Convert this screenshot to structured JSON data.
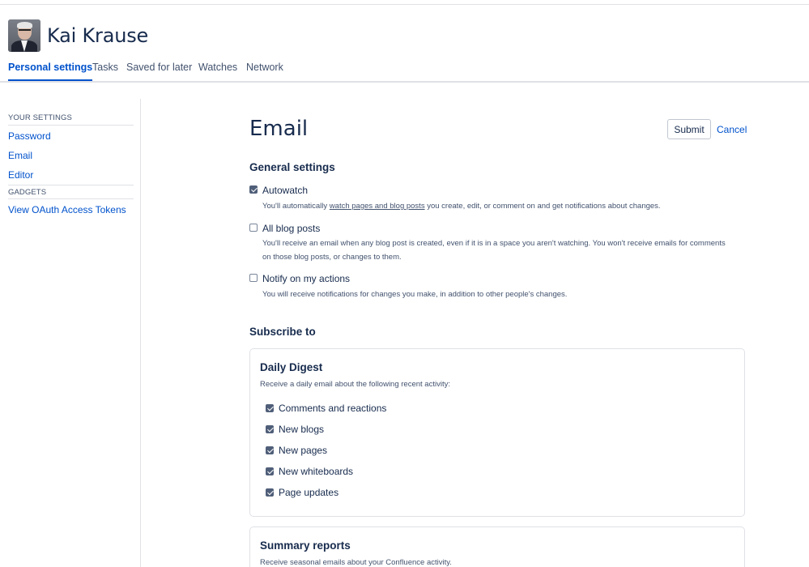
{
  "user": {
    "name": "Kai Krause"
  },
  "tabs": [
    {
      "label": "Personal settings",
      "active": true
    },
    {
      "label": "Tasks",
      "active": false
    },
    {
      "label": "Saved for later",
      "active": false
    },
    {
      "label": "Watches",
      "active": false
    },
    {
      "label": "Network",
      "active": false
    }
  ],
  "sidebar": {
    "your_settings_heading": "YOUR SETTINGS",
    "items": [
      {
        "label": "Password"
      },
      {
        "label": "Email"
      },
      {
        "label": "Editor"
      }
    ],
    "gadgets_heading": "GADGETS",
    "gadget_items": [
      {
        "label": "View OAuth Access Tokens"
      }
    ]
  },
  "page": {
    "title": "Email",
    "submit_label": "Submit",
    "cancel_label": "Cancel"
  },
  "general": {
    "heading": "General settings",
    "options": [
      {
        "label": "Autowatch",
        "checked": true,
        "desc_before": "You'll automatically ",
        "desc_link": "watch pages and blog posts",
        "desc_after": " you create, edit, or comment on and get notifications about changes."
      },
      {
        "label": "All blog posts",
        "checked": false,
        "desc_line1": "You'll receive an email when any blog post is created, even if it is in a space you aren't watching. You won't receive emails for comments",
        "desc_line2": "on those blog posts, or changes to them."
      },
      {
        "label": "Notify on my actions",
        "checked": false,
        "desc": "You will receive notifications for changes you make, in addition to other people's changes."
      }
    ]
  },
  "subscribe": {
    "heading": "Subscribe to",
    "daily_digest": {
      "title": "Daily Digest",
      "desc": "Receive a daily email about the following recent activity:",
      "items": [
        {
          "label": "Comments and reactions",
          "checked": true
        },
        {
          "label": "New blogs",
          "checked": true
        },
        {
          "label": "New pages",
          "checked": true
        },
        {
          "label": "New whiteboards",
          "checked": true
        },
        {
          "label": "Page updates",
          "checked": true
        }
      ]
    },
    "summary_reports": {
      "title": "Summary reports",
      "desc": "Receive seasonal emails about your Confluence activity."
    }
  }
}
